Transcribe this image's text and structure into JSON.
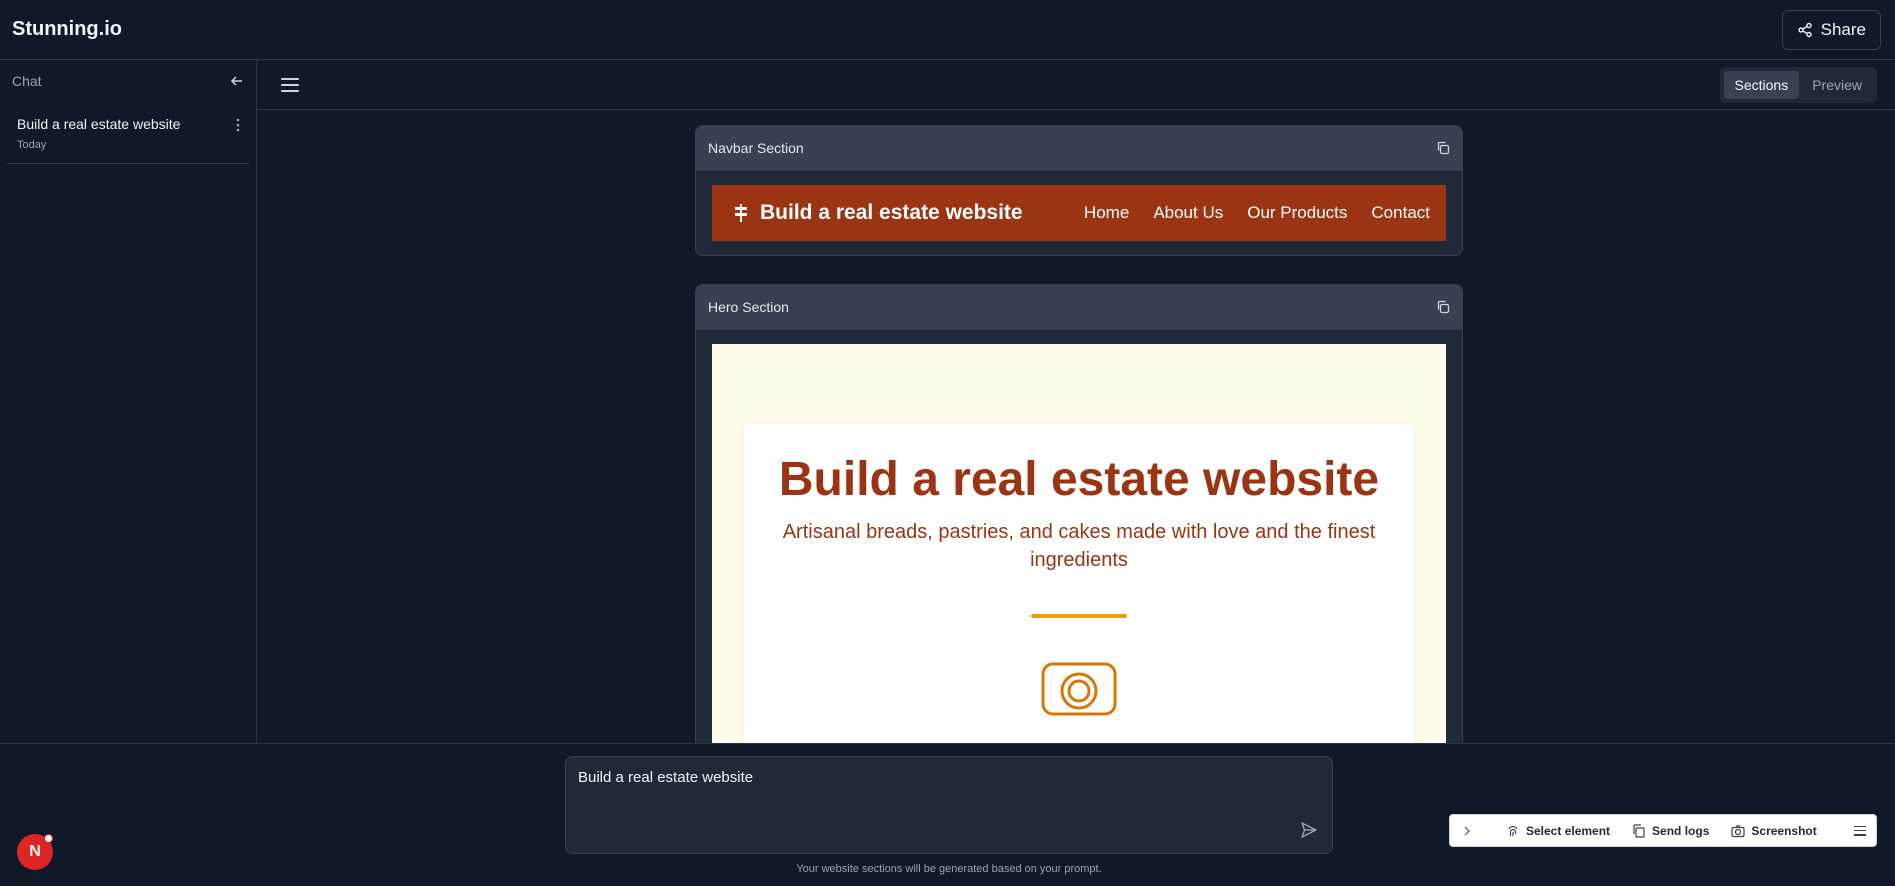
{
  "app": {
    "title": "Stunning.io",
    "share_label": "Share"
  },
  "sidebar": {
    "title": "Chat",
    "items": [
      {
        "title": "Build a real estate website",
        "date": "Today"
      }
    ]
  },
  "toolbar": {
    "tabs": [
      {
        "label": "Sections",
        "active": true
      },
      {
        "label": "Preview",
        "active": false
      }
    ]
  },
  "sections": [
    {
      "title": "Navbar Section",
      "navbar": {
        "brand": "Build a real estate website",
        "links": [
          "Home",
          "About Us",
          "Our Products",
          "Contact"
        ],
        "background": "#9a3412"
      }
    },
    {
      "title": "Hero Section",
      "hero": {
        "heading": "Build a real estate website",
        "subheading": "Artisanal breads, pastries, and cakes made with love and the finest ingredients",
        "accent": "#f59e0b",
        "icon": "camera-icon"
      }
    }
  ],
  "prompt": {
    "value": "Build a real estate website",
    "hint": "Your website sections will be generated based on your prompt."
  },
  "devtools": {
    "select_label": "Select element",
    "logs_label": "Send logs",
    "screenshot_label": "Screenshot"
  },
  "user": {
    "avatar_initial": "N"
  }
}
